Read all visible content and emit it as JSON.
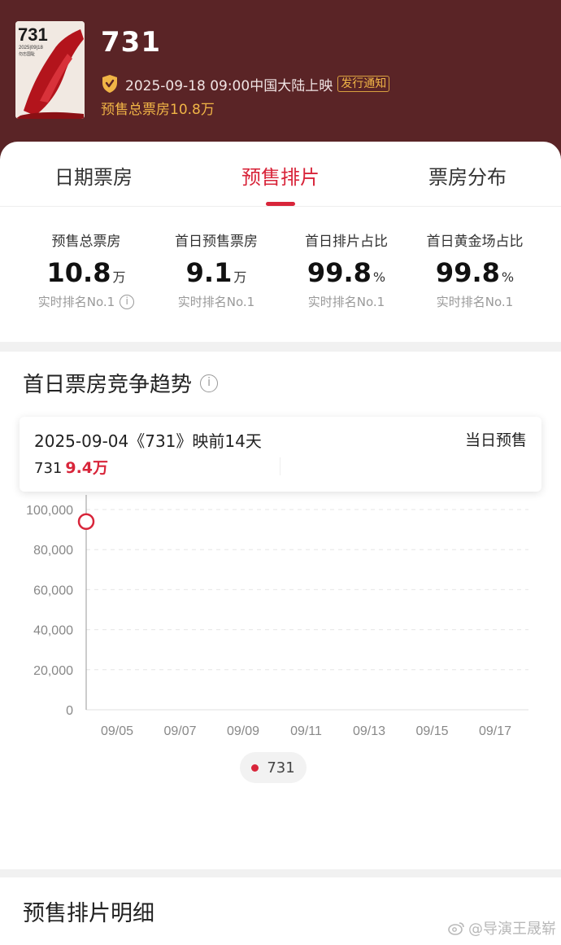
{
  "header": {
    "poster_title": "731",
    "poster_date": "2025|09|18",
    "poster_subtitle": "勿忘国耻",
    "movie_title": "731",
    "release_info": "2025-09-18 09:00中国大陆上映",
    "notify_tag": "发行通知",
    "presale_summary": "预售总票房10.8万"
  },
  "tabs": [
    {
      "label": "日期票房"
    },
    {
      "label": "预售排片",
      "active": true
    },
    {
      "label": "票房分布"
    }
  ],
  "stats": [
    {
      "label": "预售总票房",
      "value": "10.8",
      "unit": "万",
      "rank": "实时排名No.1"
    },
    {
      "label": "首日预售票房",
      "value": "9.1",
      "unit": "万",
      "rank": "实时排名No.1"
    },
    {
      "label": "首日排片占比",
      "value": "99.8",
      "unit": "%",
      "rank": "实时排名No.1"
    },
    {
      "label": "首日黄金场占比",
      "value": "99.8",
      "unit": "%",
      "rank": "实时排名No.1"
    }
  ],
  "trend": {
    "title": "首日票房竞争趋势",
    "tooltip": {
      "date_line": "2025-09-04《731》映前14天",
      "right_label": "当日预售",
      "series_name": "731",
      "series_value": "9.4万"
    },
    "legend": "731"
  },
  "chart_data": {
    "type": "line",
    "x": [
      "09/04"
    ],
    "x_tick_labels": [
      "09/05",
      "09/07",
      "09/09",
      "09/11",
      "09/13",
      "09/15",
      "09/17"
    ],
    "series": [
      {
        "name": "731",
        "values": [
          94000
        ]
      }
    ],
    "y_tick_labels": [
      "100,000",
      "80,000",
      "60,000",
      "40,000",
      "20,000",
      "0"
    ],
    "ylim": [
      0,
      100000
    ],
    "grid": true
  },
  "detail": {
    "title": "预售排片明细"
  },
  "watermark": "@导演王晟崭",
  "colors": {
    "header_bg": "#5a2426",
    "accent": "#d8253a",
    "gold": "#f0b446"
  }
}
